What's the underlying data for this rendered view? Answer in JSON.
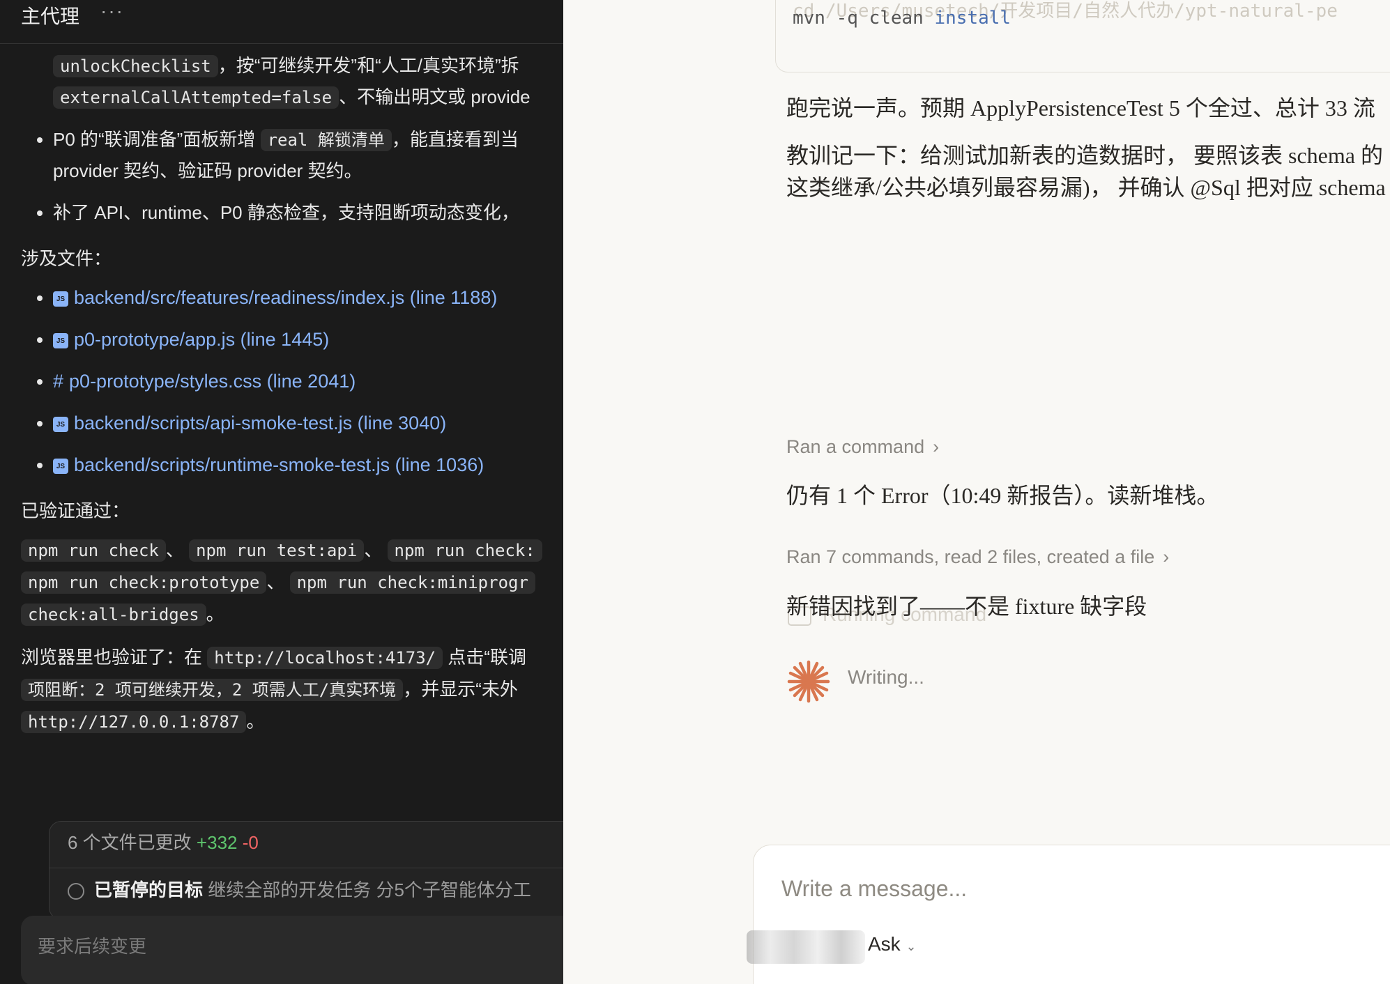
{
  "left": {
    "title": "主代理",
    "more": "···",
    "bullet0_frag": "unlockChecklist",
    "bullet0_text": "，按“可继续开发”和“人工/真实环境”拆",
    "bullet0_code2": "externalCallAttempted=false",
    "bullet0_text2": "、不输出明文或 provide",
    "bullet1_text_a": "P0 的“联调准备”面板新增",
    "bullet1_code": "real 解锁清单",
    "bullet1_text_b": "，能直接看到当",
    "bullet1_line2": "provider 契约、验证码 provider 契约。",
    "bullet2_text": "补了 API、runtime、P0 静态检查，支持阻断项动态变化，",
    "files_heading": "涉及文件：",
    "files": [
      {
        "icon": "js-icon",
        "label": "backend/src/features/readiness/index.js (line 1188)"
      },
      {
        "icon": "js-icon",
        "label": "p0-prototype/app.js (line 1445)"
      },
      {
        "icon": "hash-icon",
        "label": "p0-prototype/styles.css (line 2041)"
      },
      {
        "icon": "js-icon",
        "label": "backend/scripts/api-smoke-test.js (line 3040)"
      },
      {
        "icon": "js-icon",
        "label": "backend/scripts/runtime-smoke-test.js (line 1036)"
      }
    ],
    "verified_heading": "已验证通过：",
    "cmds": [
      "npm run check",
      "npm run test:api",
      "npm run check:",
      "npm run check:prototype",
      "npm run check:miniprogr",
      "check:all-bridges"
    ],
    "sep": "、",
    "period": "。",
    "browser_a": "浏览器里也验证了：在",
    "browser_url": "http://localhost:4173/",
    "browser_b": "点击“联调",
    "browser_code2": "项阻断：2 项可继续开发，2 项需人工/真实环境",
    "browser_c": "，并显示“未外",
    "browser_url2": "http://127.0.0.1:8787",
    "changes_label": "6 个文件已更改",
    "changes_plus": "+332",
    "changes_minus": "-0",
    "goal_label": "已暂停的目标",
    "goal_text": "继续全部的开发任务 分5个子智能体分工",
    "input_placeholder": "要求后续变更"
  },
  "right": {
    "code_faded": "cd /Users/musetech/开发项目/自然人代办/ypt-natural-pe",
    "code_cmd_a": "mvn -q clean",
    "code_cmd_b": "install",
    "p1": "跑完说一声。预期 ApplyPersistenceTest 5 个全过、总计 33 流",
    "p2_line1": "教训记一下：给测试加新表的造数据时， 要照该表 schema 的",
    "p2_line2": "这类继承/公共必填列最容易漏)， 并确认 @Sql 把对应 schema",
    "ran1": "Ran a command",
    "msg1": "仍有 1 个 Error（10:49 新报告）。读新堆栈。",
    "ran2": "Ran 7 commands, read 2 files, created a file",
    "msg2": "新错因找到了——不是 fixture 缺字段",
    "ghost": "Running command",
    "writing": "Writing...",
    "composer_placeholder": "Write a message...",
    "mode": "Ask",
    "spark_color": "#d9774f"
  }
}
